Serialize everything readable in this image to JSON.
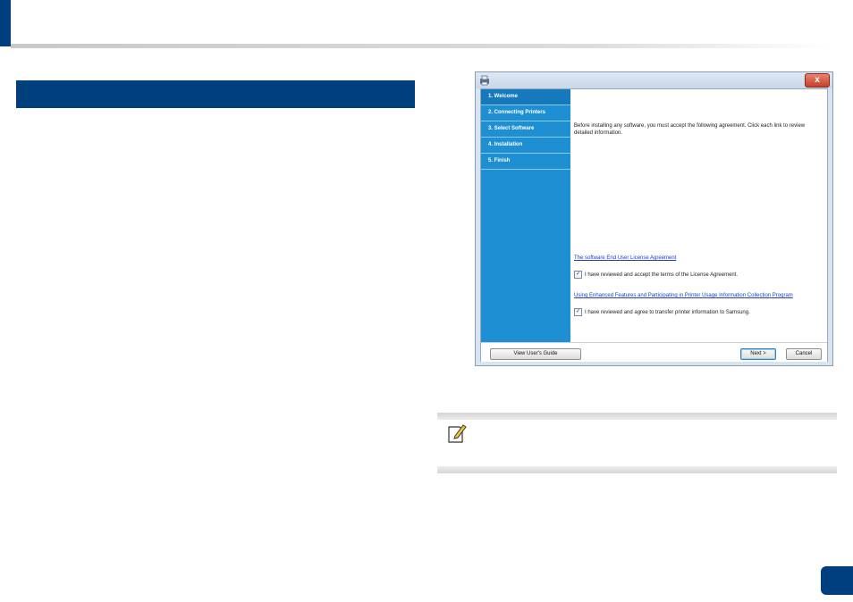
{
  "colors": {
    "brand_navy": "#003f7d",
    "sidebar_blue": "#1e8fd2",
    "link_blue": "#1f3fbf"
  },
  "installer": {
    "close_label": "x",
    "steps": [
      {
        "label": "1. Welcome"
      },
      {
        "label": "2. Connecting Printers"
      },
      {
        "label": "3. Select Software"
      },
      {
        "label": "4. Installation"
      },
      {
        "label": "5. Finish"
      }
    ],
    "intro_text": "Before installing any software, you must accept the following agreement. Click each link to review detailed information.",
    "eula_link": "The software End User License Agreement",
    "eula_checkbox_label": "I have reviewed and accept the terms of the License Agreement.",
    "eula_checked": true,
    "usage_link": "Using Enhanced Features and Participating in Printer Usage Information Collection Program",
    "usage_checkbox_label": "I have reviewed and agree to transfer printer information to Samsung.",
    "usage_checked": true,
    "view_guide_button": "View User's Guide",
    "next_button": "Next >",
    "cancel_button": "Cancel"
  },
  "icons": {
    "app_icon": "installer-app-icon",
    "note_icon": "note-pencil-icon",
    "checkmark": "✓"
  }
}
